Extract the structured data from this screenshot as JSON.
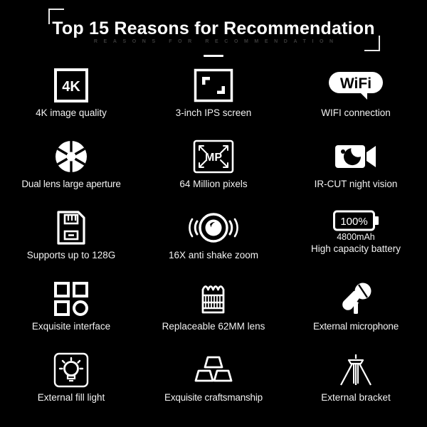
{
  "header": {
    "title": "Top 15 Reasons for Recommendation",
    "subtitle": "REASONS FOR RECOMMENDATION"
  },
  "colors": {
    "background": "#000000",
    "foreground": "#ffffff",
    "subtitle": "#3b3b3b",
    "caption": "#f2f2f2"
  },
  "features": [
    [
      {
        "icon": "4k-square-icon",
        "label": "4K image quality",
        "badge": "4K"
      },
      {
        "icon": "ips-screen-icon",
        "label": "3-inch IPS screen"
      },
      {
        "icon": "wifi-badge-icon",
        "label": "WIFI connection",
        "badge": "WiFi"
      }
    ],
    [
      {
        "icon": "aperture-icon",
        "label": "Dual lens large aperture"
      },
      {
        "icon": "megapixel-frame-icon",
        "label": "64 Million pixels",
        "badge": "MP"
      },
      {
        "icon": "night-vision-camcorder-icon",
        "label": "IR-CUT night vision"
      }
    ],
    [
      {
        "icon": "sd-card-icon",
        "label": "Supports up to 128G"
      },
      {
        "icon": "anti-shake-lens-icon",
        "label": "16X anti shake zoom"
      },
      {
        "icon": "battery-icon",
        "label": "High capacity battery",
        "badge": "100%",
        "sublabel": "4800mAh"
      }
    ],
    [
      {
        "icon": "interface-grid-icon",
        "label": "Exquisite interface"
      },
      {
        "icon": "lens-barrel-icon",
        "label": "Replaceable 62MM lens"
      },
      {
        "icon": "microphone-icon",
        "label": "External microphone"
      }
    ],
    [
      {
        "icon": "fill-light-icon",
        "label": "External fill light"
      },
      {
        "icon": "gold-ingot-icon",
        "label": "Exquisite craftsmanship"
      },
      {
        "icon": "tripod-icon",
        "label": "External bracket"
      }
    ]
  ]
}
